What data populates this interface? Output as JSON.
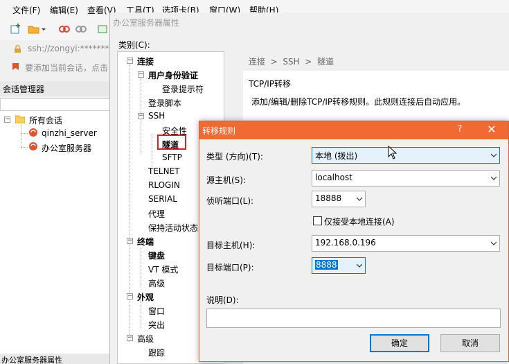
{
  "menubar": {
    "items": [
      "文件(F)",
      "编辑(E)",
      "查看(V)",
      "工具(T)",
      "选项卡(B)",
      "窗口(W)",
      "帮助(H)"
    ]
  },
  "address": {
    "text": "ssh://zongyi:*********"
  },
  "hint": {
    "text": "要添加当前会话，点击"
  },
  "session_panel": {
    "title": "会话管理器",
    "root": "所有会话",
    "sessions": [
      "qinzhi_server",
      "办公室服务器"
    ]
  },
  "status_bottom": "办公室服务器属性",
  "props_dialog": {
    "title": "办公室服务器属性",
    "category_label": "类别(C):",
    "tree": {
      "connection": "连接",
      "auth": "用户身份验证",
      "login_prompt": "登录提示符",
      "login_script": "登录脚本",
      "ssh": "SSH",
      "security": "安全性",
      "tunnel": "隧道",
      "sftp": "SFTP",
      "telnet": "TELNET",
      "rlogin": "RLOGIN",
      "serial": "SERIAL",
      "proxy": "代理",
      "keepalive": "保持活动状态",
      "terminal": "终端",
      "keyboard": "键盘",
      "vt_mode": "VT 模式",
      "advanced1": "高级",
      "appearance": "外观",
      "window": "窗口",
      "highlight": "突出",
      "advanced2": "高级",
      "trace": "跟踪"
    },
    "breadcrumb": [
      "连接",
      "SSH",
      "隧道"
    ],
    "section_title": "TCP/IP转移",
    "section_desc": "添加/编辑/删除TCP/IP转移规则。此规则连接后自动应用。"
  },
  "forward_dialog": {
    "title": "转移规则",
    "help": "?",
    "close": "✕",
    "type_label": "类型 (方向)(T):",
    "type_value": "本地 (拨出)",
    "source_host_label": "源主机(S):",
    "source_host_value": "localhost",
    "listen_port_label": "侦听端口(L):",
    "listen_port_value": "18888",
    "local_only_label": "仅接受本地连接(A)",
    "local_only_checked": false,
    "target_host_label": "目标主机(H):",
    "target_host_value": "192.168.0.196",
    "target_port_label": "目标端口(P):",
    "target_port_value": "8888",
    "desc_label": "说明(D):",
    "desc_value": "",
    "ok": "确定",
    "cancel": "取消"
  },
  "colors": {
    "dialog_title_bg": "#f06a32",
    "highlight_border": "#e01c1c",
    "focus_blue": "#0078d7"
  }
}
